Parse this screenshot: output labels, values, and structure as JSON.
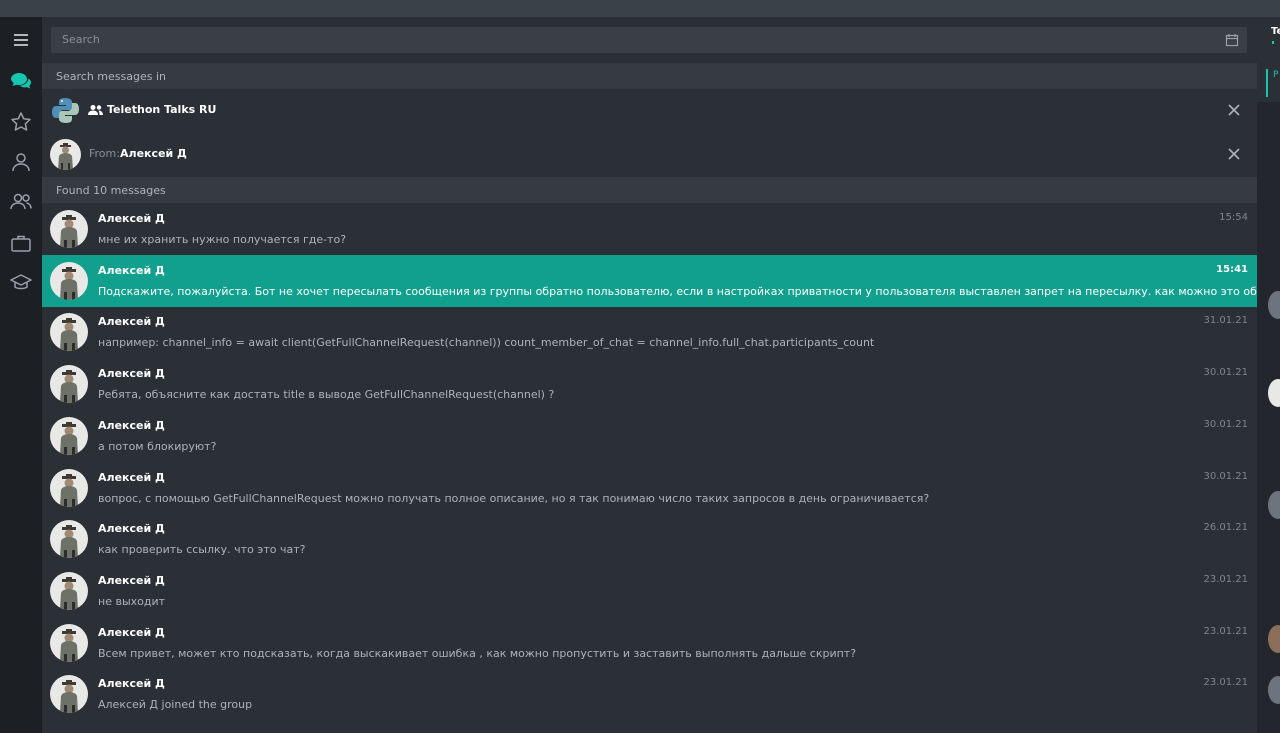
{
  "search": {
    "placeholder": "Search"
  },
  "scope": {
    "header": "Search messages in",
    "chat_name": "Telethon Talks RU",
    "from_label": "From:",
    "from_user": "Алексей Д"
  },
  "results": {
    "header": "Found 10 messages",
    "items": [
      {
        "name": "Алексей Д",
        "time": "15:54",
        "text": "мне их хранить нужно получается где-то?"
      },
      {
        "name": "Алексей Д",
        "time": "15:41",
        "text": "Подскажите, пожалуйста. Бот не хочет пересылать сообщения из группы обратно пользователю, если в настройках приватности у пользователя  выставлен запрет на пересылку. как можно это обойти?"
      },
      {
        "name": "Алексей Д",
        "time": "31.01.21",
        "text": "например:  channel_info = await client(GetFullChannelRequest(channel)) count_member_of_chat = channel_info.full_chat.participants_count"
      },
      {
        "name": "Алексей Д",
        "time": "30.01.21",
        "text": "Ребята, объясните как достать title в выводе GetFullChannelRequest(channel) ?"
      },
      {
        "name": "Алексей Д",
        "time": "30.01.21",
        "text": "а потом блокируют?"
      },
      {
        "name": "Алексей Д",
        "time": "30.01.21",
        "text": "вопрос, с помощью GetFullChannelRequest можно получать полное описание, но я так понимаю число таких запросов в день ограничивается?"
      },
      {
        "name": "Алексей Д",
        "time": "26.01.21",
        "text": "как проверить ссылку. что это чат?"
      },
      {
        "name": "Алексей Д",
        "time": "23.01.21",
        "text": "не выходит"
      },
      {
        "name": "Алексей Д",
        "time": "23.01.21",
        "text": "Всем привет, может кто подсказать, когда выскакивает ошибка , как можно пропустить и заставить выполнять дальше скрипт?"
      },
      {
        "name": "Алексей Д",
        "time": "23.01.21",
        "text": "Алексей Д joined the group"
      }
    ]
  },
  "rail": {
    "icons": [
      "menu-icon",
      "chats-icon",
      "star-icon",
      "user-icon",
      "groups-icon",
      "briefcase-icon",
      "graduation-cap-icon"
    ],
    "accent": "#17c5b1"
  },
  "right_panel": {
    "title_fragment": "Te",
    "pinned_fragment": "P"
  },
  "colors": {
    "selected": "#12a08e",
    "background": "#2b2f36"
  }
}
